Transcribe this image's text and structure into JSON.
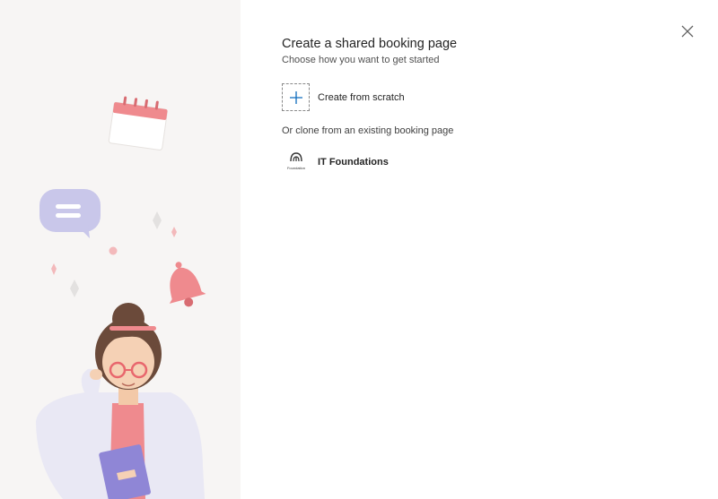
{
  "dialog": {
    "title": "Create a shared booking page",
    "subtitle": "Choose how you want to get started",
    "create_from_scratch_label": "Create from scratch",
    "clone_label": "Or clone from an existing booking page",
    "close_icon": "close-icon",
    "plus_icon": "plus-icon"
  },
  "existing_pages": [
    {
      "name": "IT Foundations",
      "logo_text": "Foundation",
      "icon": "booking-page-logo"
    }
  ],
  "colors": {
    "accent": "#0f6cbd",
    "left_panel_bg": "#f7f5f4",
    "illustration_pink": "#ef8a8e",
    "illustration_lavender": "#c9c7ea"
  }
}
